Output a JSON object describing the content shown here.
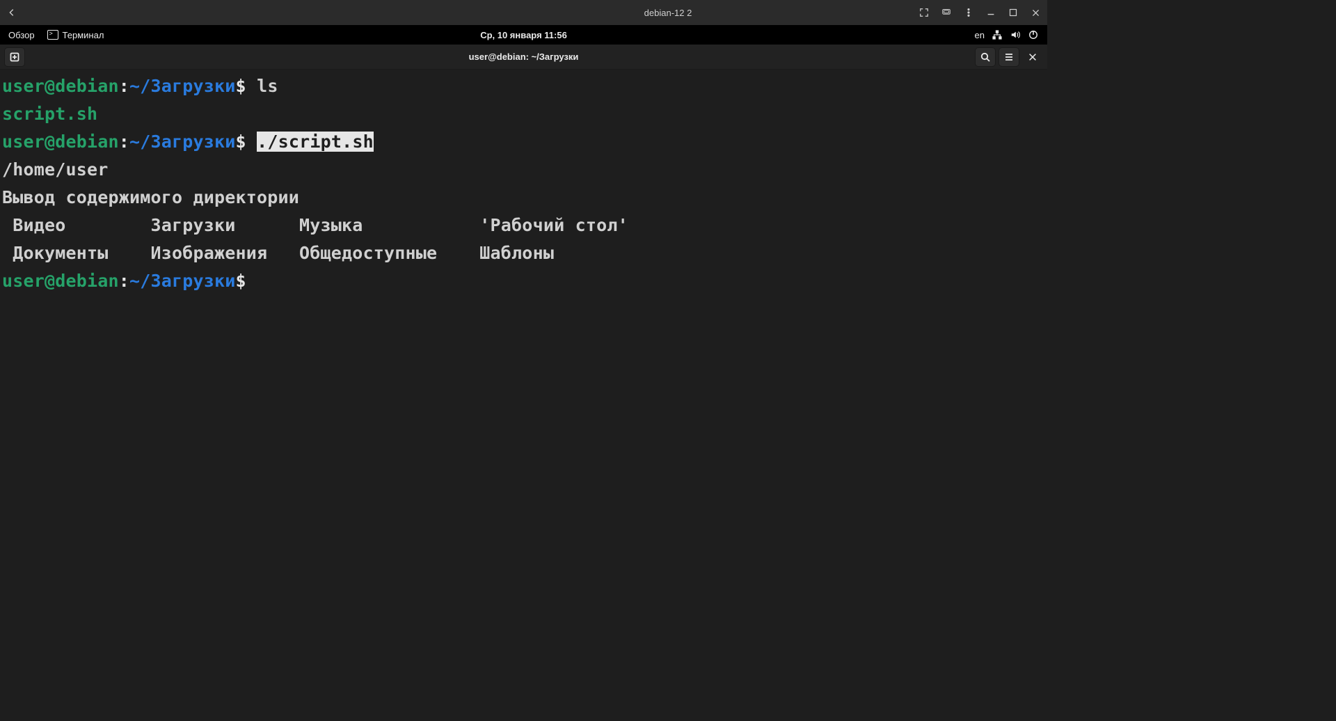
{
  "vm_titlebar": {
    "title": "debian-12 2"
  },
  "gnome_bar": {
    "activities": "Обзор",
    "app_name": "Терминал",
    "clock": "Ср, 10 января  11:56",
    "lang": "en"
  },
  "term_header": {
    "title": "user@debian: ~/Загрузки"
  },
  "terminal": {
    "user": "user@debian",
    "sep": ":",
    "path": "~/Загрузки",
    "dollar": "$",
    "cmd1": "ls",
    "ls_out": "script.sh",
    "cmd2_plain": " ",
    "cmd2_hl": "./script.sh",
    "out_path": "/home/user",
    "out_heading": "Вывод содержимого директории",
    "col_row1": " Видео        Загрузки      Музыка           'Рабочий стол'",
    "col_row2": " Документы    Изображения   Общедоступные    Шаблоны"
  }
}
